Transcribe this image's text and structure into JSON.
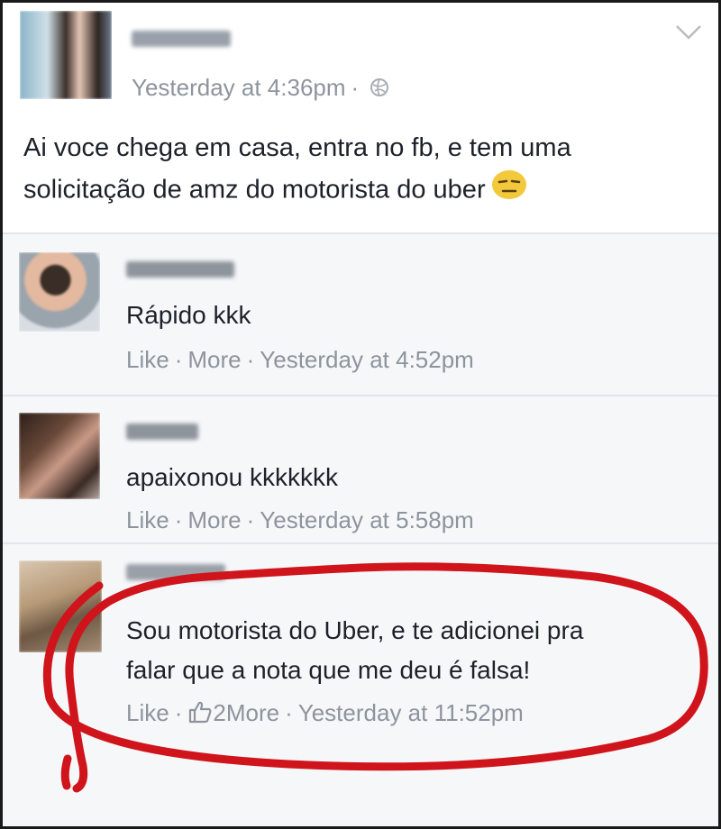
{
  "post": {
    "author": "",
    "time": "Yesterday at 4:36pm",
    "text_line1": "Ai voce chega em casa, entra no fb, e tem uma",
    "text_line2": "solicitação de amz do motorista do uber"
  },
  "actions": {
    "like": "Like",
    "more": "More",
    "sep": "·"
  },
  "comments": [
    {
      "text": "Rápido kkk",
      "time": "Yesterday at 4:52pm"
    },
    {
      "text": "apaixonou kkkkkkk",
      "time": "Yesterday at 5:58pm"
    },
    {
      "text_line1": "Sou motorista do Uber, e te adicionei pra",
      "text_line2": "falar que a nota que me deu é falsa!",
      "likes": "2",
      "time": "Yesterday at 11:52pm"
    }
  ],
  "icons": {
    "chevron": "chevron-down-icon",
    "globe": "globe-icon",
    "emoji": "unamused-face-emoji",
    "thumb": "thumbs-up-icon"
  },
  "colors": {
    "meta": "#8d949e",
    "annotation": "#d0141c",
    "comment_bg": "#f6f7f9"
  }
}
